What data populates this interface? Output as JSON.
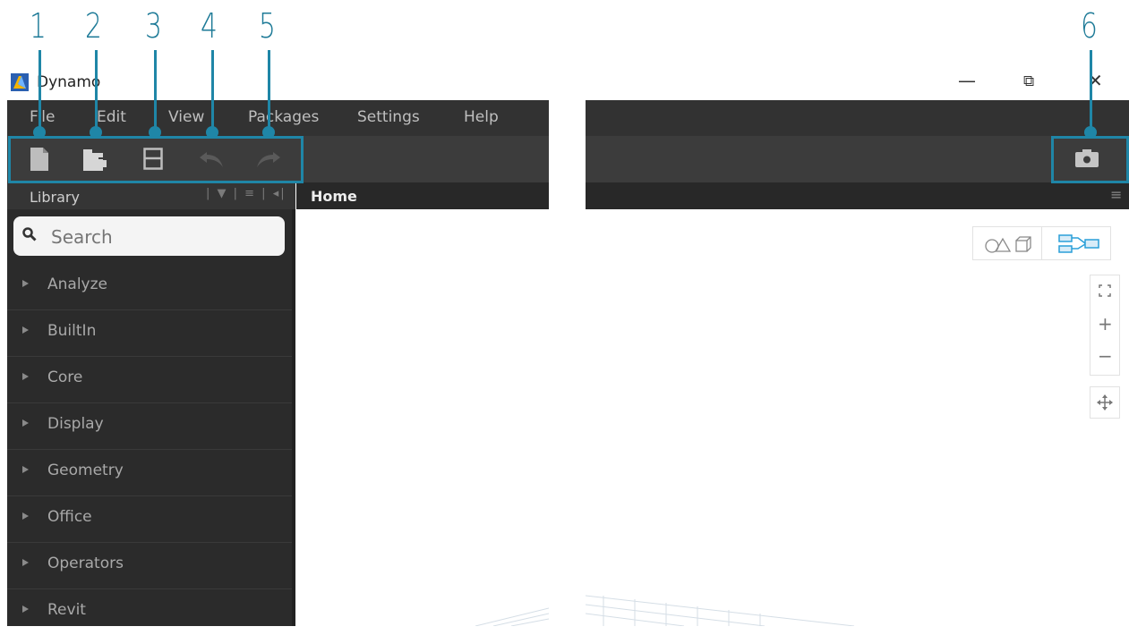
{
  "callouts": [
    "1",
    "2",
    "3",
    "4",
    "5",
    "6"
  ],
  "window": {
    "title": "Dynamo",
    "minimize": "—",
    "restore": "⧉",
    "close": "✕"
  },
  "menu": [
    "File",
    "Edit",
    "View",
    "Packages",
    "Settings",
    "Help"
  ],
  "toolbar": {
    "new_icon": "new-file-icon",
    "open_icon": "open-folder-icon",
    "save_icon": "save-icon",
    "undo_icon": "undo-icon",
    "redo_icon": "redo-icon",
    "screenshot_icon": "camera-icon"
  },
  "library": {
    "title": "Library",
    "controls": "|  ▼  |  ≡  |  ◂|",
    "search_placeholder": "Search",
    "categories": [
      "Analyze",
      "BuiltIn",
      "Core",
      "Display",
      "Geometry",
      "Office",
      "Operators",
      "Revit"
    ]
  },
  "workspace": {
    "tab_label": "Home",
    "right_menu_icon": "≡"
  },
  "view_controls": {
    "geometry_view_icon": "geometry-view-icon",
    "graph_view_icon": "graph-view-icon",
    "fit_icon": "fit-view-icon",
    "zoom_in": "+",
    "zoom_out": "−",
    "pan_icon": "pan-icon"
  },
  "colors": {
    "callout": "#1f86a7",
    "accent_blue": "#2a9fd8"
  }
}
